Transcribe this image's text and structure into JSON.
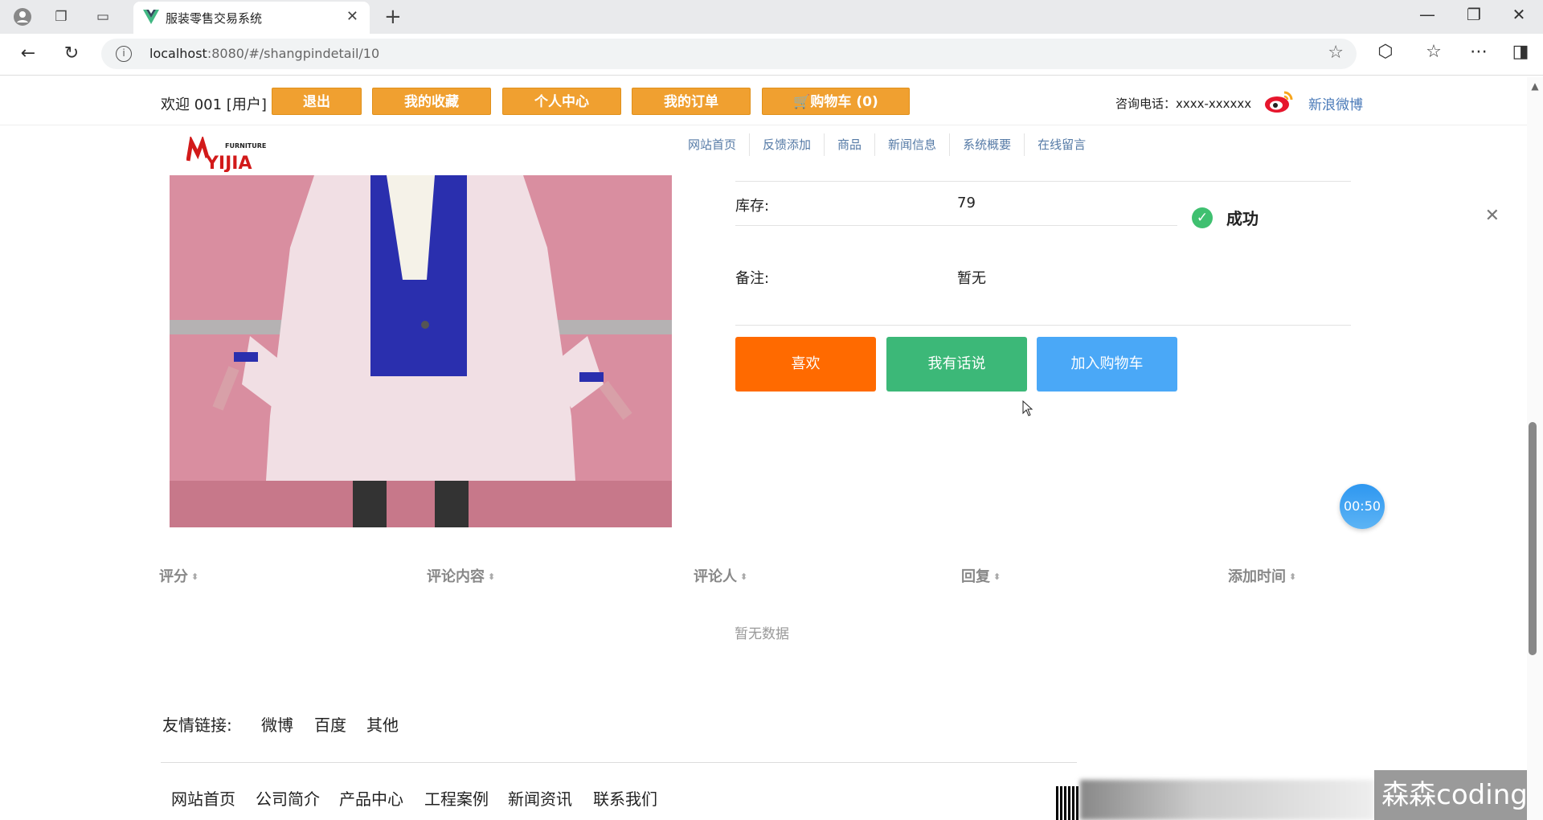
{
  "browser": {
    "tab_title": "服装零售交易系统",
    "url_host": "localhost",
    "url_rest": ":8080/#/shangpindetail/10"
  },
  "topbar": {
    "welcome": "欢迎 001 [用户]",
    "logout": "退出",
    "favorites": "我的收藏",
    "profile": "个人中心",
    "orders": "我的订单",
    "cart": "🛒购物车 (0)",
    "phone": "咨询电话：xxxx-xxxxxx",
    "weibo": "新浪微博"
  },
  "logo": {
    "line1": "FURNITURE",
    "line2": "YIJIA"
  },
  "nav": [
    "网站首页",
    "反馈添加",
    "商品",
    "新闻信息",
    "系统概要",
    "在线留言"
  ],
  "details": {
    "stock_label": "库存:",
    "stock_value": "79",
    "remark_label": "备注:",
    "remark_value": "暂无"
  },
  "actions": {
    "like": "喜欢",
    "comment": "我有话说",
    "add_cart": "加入购物车",
    "colors": {
      "like": "#ff6a00",
      "comment": "#3cb878",
      "add_cart": "#4aa8f7"
    }
  },
  "toast": {
    "message": "成功"
  },
  "timer": "00:50",
  "comments": {
    "headers": [
      "评分",
      "评论内容",
      "评论人",
      "回复",
      "添加时间"
    ],
    "empty_text": "暂无数据"
  },
  "footer": {
    "friend_label": "友情链接:",
    "friend_links": [
      "微博",
      "百度",
      "其他"
    ],
    "nav": [
      "网站首页",
      "公司简介",
      "产品中心",
      "工程案例",
      "新闻资讯",
      "联系我们"
    ]
  },
  "watermark": "森森coding"
}
